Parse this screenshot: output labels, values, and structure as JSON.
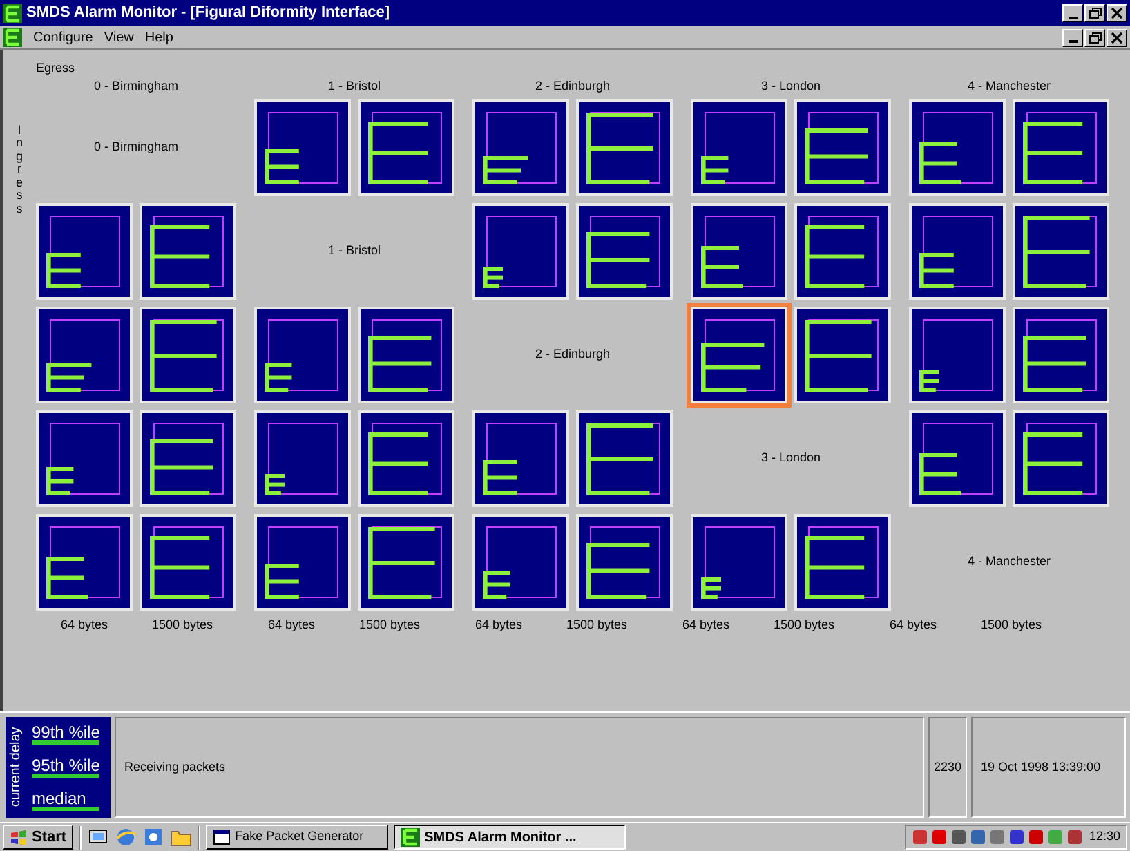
{
  "window": {
    "title": "SMDS Alarm Monitor - [Figural Diformity Interface]"
  },
  "menu": [
    {
      "label": "Configure"
    },
    {
      "label": "View"
    },
    {
      "label": "Help"
    }
  ],
  "egress": {
    "label": "Egress",
    "columns": [
      "0 - Birmingham",
      "1 - Bristol",
      "2 - Edinburgh",
      "3 - London",
      "4 - Manchester"
    ]
  },
  "ingress": {
    "label": "Ingress",
    "rows": [
      {
        "cells": [
          {
            "kind": "label",
            "text": "0 - Birmingham"
          },
          {
            "kind": "pair",
            "tiles": [
              {
                "selected": false
              },
              {
                "selected": false
              }
            ]
          },
          {
            "kind": "pair",
            "tiles": [
              {
                "selected": false
              },
              {
                "selected": false
              }
            ]
          },
          {
            "kind": "pair",
            "tiles": [
              {
                "selected": false
              },
              {
                "selected": false
              }
            ]
          },
          {
            "kind": "pair",
            "tiles": [
              {
                "selected": false
              },
              {
                "selected": false
              }
            ]
          }
        ]
      },
      {
        "cells": [
          {
            "kind": "pair",
            "tiles": [
              {
                "selected": false
              },
              {
                "selected": false
              }
            ]
          },
          {
            "kind": "label",
            "text": "1 - Bristol"
          },
          {
            "kind": "pair",
            "tiles": [
              {
                "selected": false
              },
              {
                "selected": false
              }
            ]
          },
          {
            "kind": "pair",
            "tiles": [
              {
                "selected": false
              },
              {
                "selected": false
              }
            ]
          },
          {
            "kind": "pair",
            "tiles": [
              {
                "selected": false
              },
              {
                "selected": false
              }
            ]
          }
        ]
      },
      {
        "cells": [
          {
            "kind": "pair",
            "tiles": [
              {
                "selected": false
              },
              {
                "selected": false
              }
            ]
          },
          {
            "kind": "pair",
            "tiles": [
              {
                "selected": false
              },
              {
                "selected": false
              }
            ]
          },
          {
            "kind": "label",
            "text": "2 - Edinburgh"
          },
          {
            "kind": "pair",
            "tiles": [
              {
                "selected": true
              },
              {
                "selected": false
              }
            ]
          },
          {
            "kind": "pair",
            "tiles": [
              {
                "selected": false
              },
              {
                "selected": false
              }
            ]
          }
        ]
      },
      {
        "cells": [
          {
            "kind": "pair",
            "tiles": [
              {
                "selected": false
              },
              {
                "selected": false
              }
            ]
          },
          {
            "kind": "pair",
            "tiles": [
              {
                "selected": false
              },
              {
                "selected": false
              }
            ]
          },
          {
            "kind": "pair",
            "tiles": [
              {
                "selected": false
              },
              {
                "selected": false
              }
            ]
          },
          {
            "kind": "label",
            "text": "3 - London"
          },
          {
            "kind": "pair",
            "tiles": [
              {
                "selected": false
              },
              {
                "selected": false
              }
            ]
          }
        ]
      },
      {
        "cells": [
          {
            "kind": "pair",
            "tiles": [
              {
                "selected": false
              },
              {
                "selected": false
              }
            ]
          },
          {
            "kind": "pair",
            "tiles": [
              {
                "selected": false
              },
              {
                "selected": false
              }
            ]
          },
          {
            "kind": "pair",
            "tiles": [
              {
                "selected": false
              },
              {
                "selected": false
              }
            ]
          },
          {
            "kind": "pair",
            "tiles": [
              {
                "selected": false
              },
              {
                "selected": false
              }
            ]
          },
          {
            "kind": "label",
            "text": "4 - Manchester"
          }
        ]
      }
    ]
  },
  "size_labels": [
    "64 bytes",
    "1500 bytes",
    "64 bytes",
    "1500 bytes",
    "64 bytes",
    "1500 bytes",
    "64 bytes",
    "1500 bytes",
    "64 bytes",
    "1500 bytes"
  ],
  "legend": {
    "title": "current delay",
    "items": [
      "99th %ile",
      "95th %ile",
      "median"
    ]
  },
  "status_bar": {
    "message": "Receiving packets",
    "count": "2230",
    "timestamp": "19 Oct 1998 13:39:00"
  },
  "taskbar": {
    "start": "Start",
    "tasks": [
      {
        "label": "Fake Packet Generator",
        "selected": false
      },
      {
        "label": "SMDS Alarm Monitor ...",
        "selected": true
      }
    ],
    "clock": "12:30"
  }
}
